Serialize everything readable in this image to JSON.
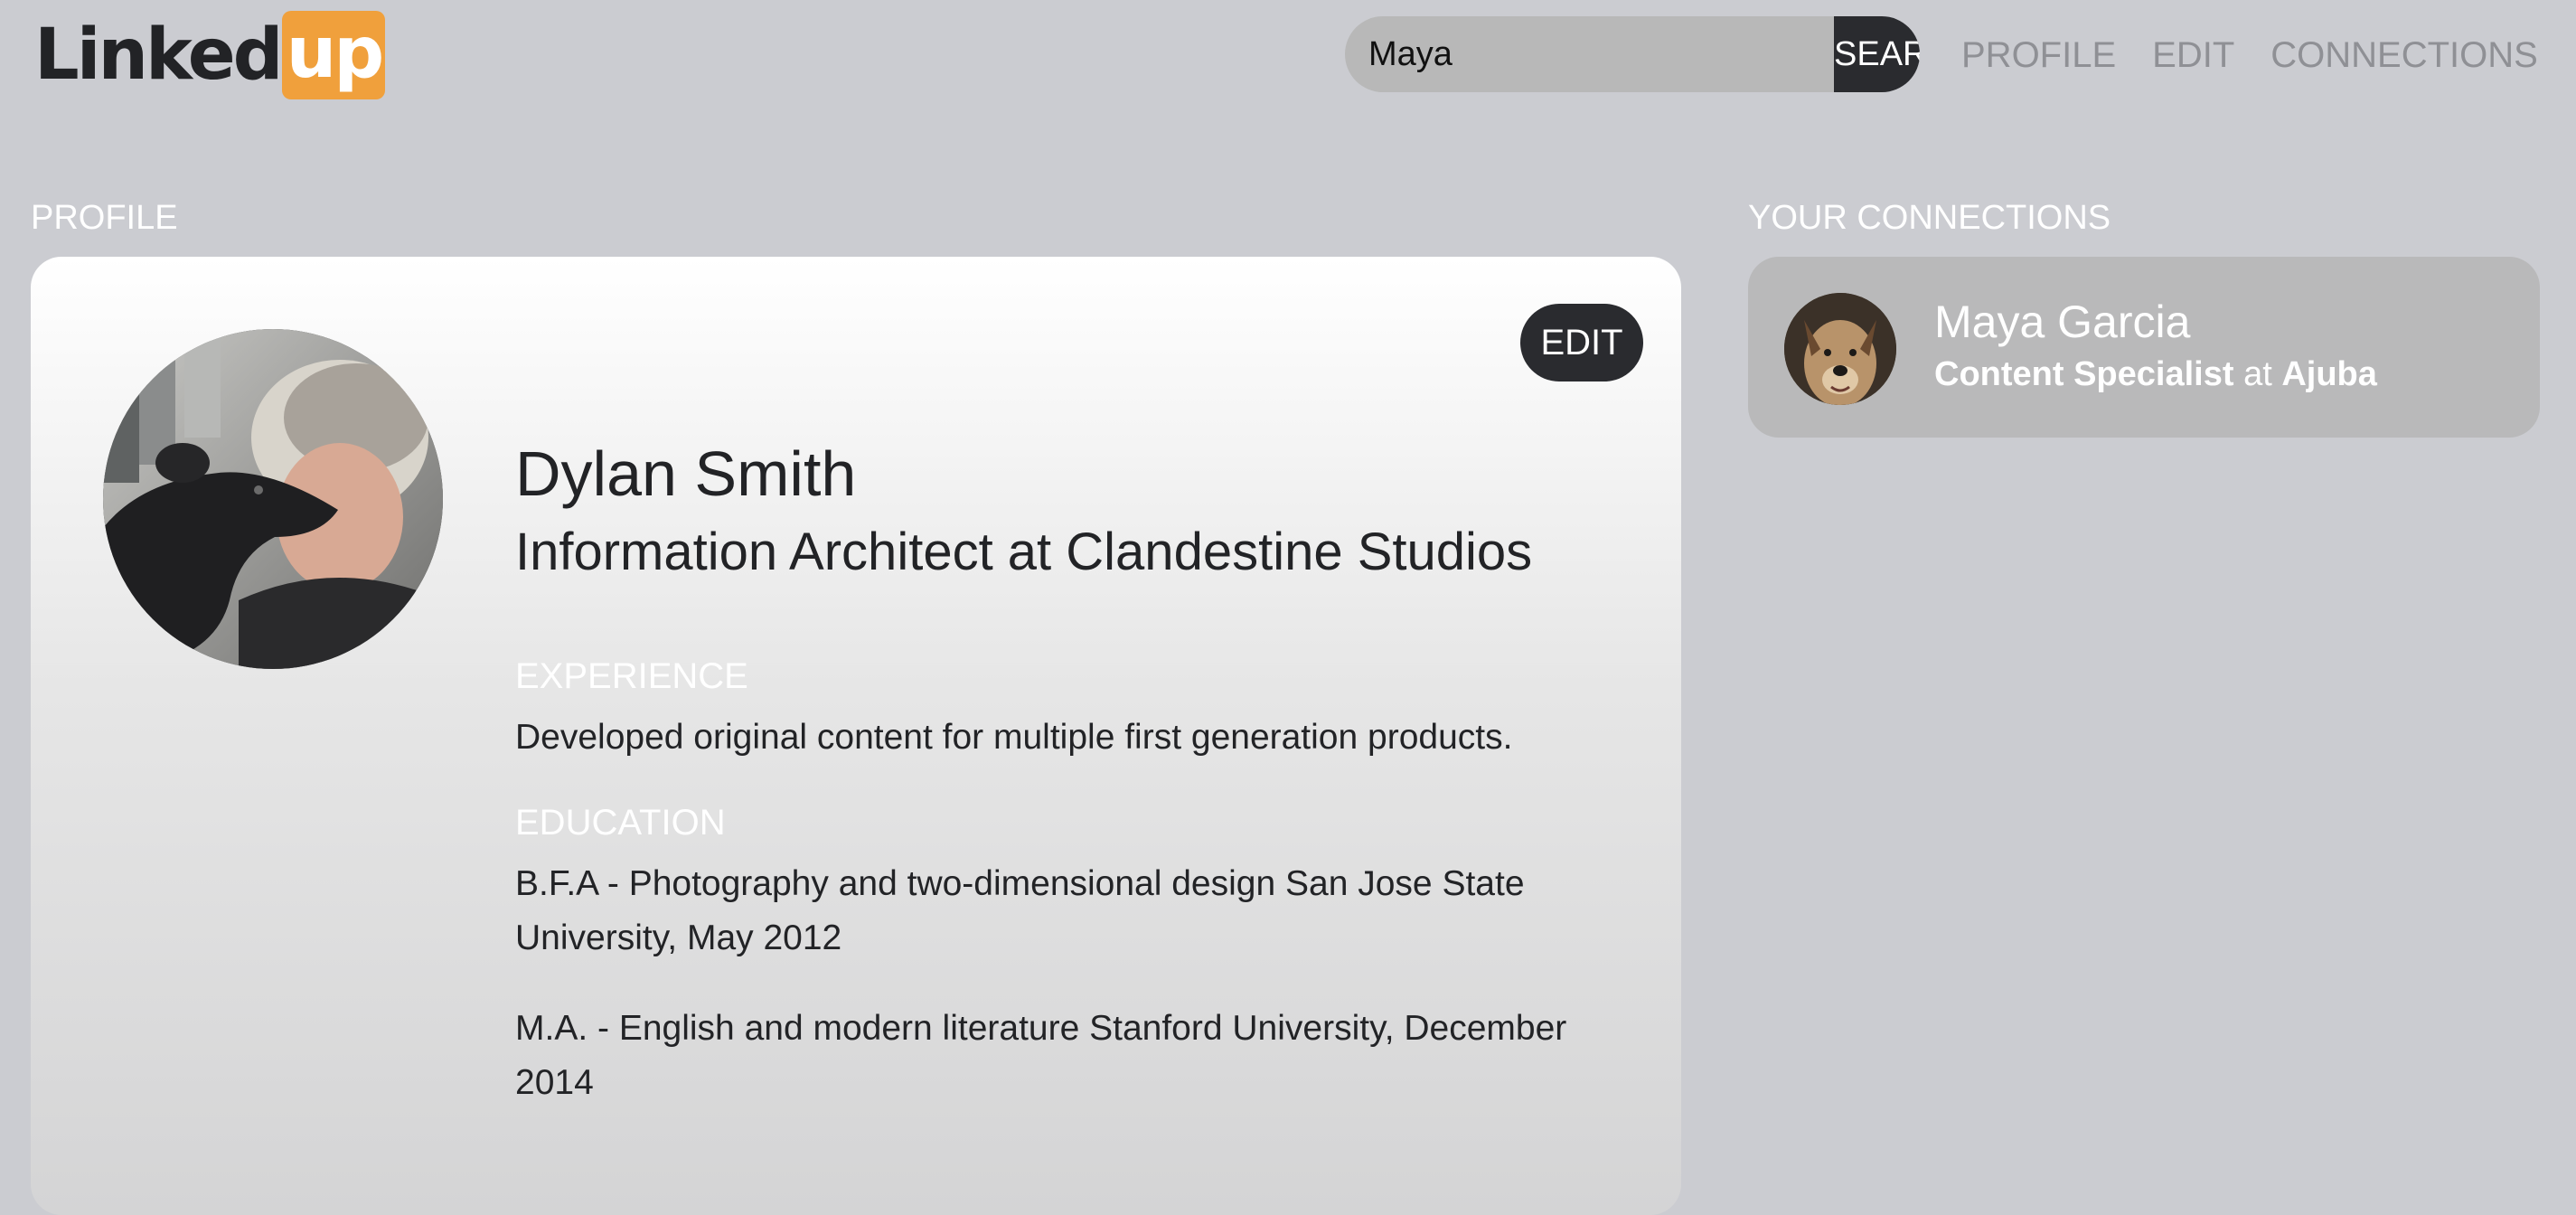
{
  "logo": {
    "main": "Linked",
    "accent": "up"
  },
  "search": {
    "value": "Maya",
    "button_label": "SEARCH"
  },
  "nav": {
    "items": [
      {
        "label": "PROFILE"
      },
      {
        "label": "EDIT"
      },
      {
        "label": "CONNECTIONS"
      }
    ]
  },
  "profile": {
    "section_label": "PROFILE",
    "edit_label": "EDIT",
    "name": "Dylan Smith",
    "headline": "Information Architect at Clandestine Studios",
    "experience_heading": "EXPERIENCE",
    "experience": "Developed original content for multiple first generation products.",
    "education_heading": "EDUCATION",
    "education": [
      "B.F.A - Photography and two-dimensional design San Jose State University, May 2012",
      "M.A. - English and modern literature Stanford University, December 2014"
    ]
  },
  "connections": {
    "section_label": "YOUR CONNECTIONS",
    "items": [
      {
        "name": "Maya Garcia",
        "role": "Content Specialist",
        "connector": "at",
        "company": "Ajuba"
      }
    ]
  },
  "colors": {
    "background": "#cbccd1",
    "accent": "#f0a03c",
    "dark": "#2a2b2f",
    "nav_text": "#8f9095",
    "connection_card": "#b9b9ba"
  },
  "icons": {
    "profile_photo": "profile-photo-avatar",
    "connection_photo": "connection-photo-avatar"
  }
}
